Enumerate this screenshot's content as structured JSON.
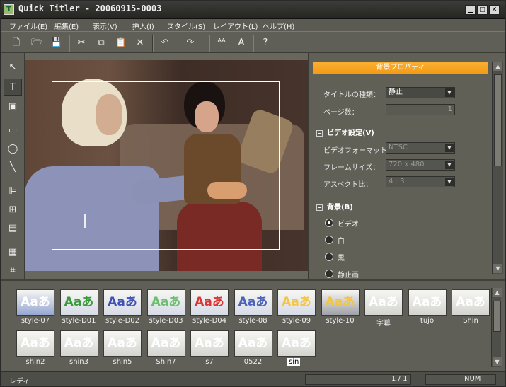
{
  "window": {
    "title": "Quick Titler - 20060915-0003"
  },
  "menu": [
    "ファイル(E)",
    "編集(E)",
    "表示(V)",
    "挿入(I)",
    "スタイル(S)",
    "レイアウト(L)",
    "ヘルプ(H)"
  ],
  "toolbar": {
    "icons": [
      "new-file-icon",
      "open-folder-icon",
      "save-icon",
      "cut-icon",
      "copy-icon",
      "paste-icon",
      "delete-icon",
      "undo-icon",
      "redo-icon",
      "text-style-icon",
      "text-effect-icon",
      "help-icon"
    ]
  },
  "left_tools": [
    "pointer-icon",
    "text-tool-icon",
    "image-tool-icon",
    "rectangle-tool-icon",
    "ellipse-tool-icon",
    "line-tool-icon",
    "align-left-icon",
    "align-center-icon",
    "layer-icon",
    "grid-icon",
    "safe-area-icon"
  ],
  "properties": {
    "header": "背景プロパティ",
    "title_type_label": "タイトルの種類：",
    "title_type_value": "静止",
    "page_count_label": "ページ数：",
    "page_count_value": "1",
    "video_section": "ビデオ設定(V)",
    "video_format_label": "ビデオフォーマット：",
    "video_format_value": "NTSC",
    "frame_size_label": "フレームサイズ：",
    "frame_size_value": "720 x 480",
    "aspect_label": "アスペクト比：",
    "aspect_value": "4 : 3",
    "background_section": "背景(B)",
    "radio_video": "ビデオ",
    "radio_white": "白",
    "radio_black": "黒",
    "radio_still": "静止画"
  },
  "styles": {
    "row1": [
      {
        "name": "style-07",
        "sample": "Aaあ",
        "fg": "#ffffff",
        "bg": "#95a7d2"
      },
      {
        "name": "style-D01",
        "sample": "Aaあ",
        "fg": "#3a9a3a",
        "bg": "#d7dbe6"
      },
      {
        "name": "style-D02",
        "sample": "Aaあ",
        "fg": "#3f51b5",
        "bg": "#d7dbe6"
      },
      {
        "name": "style-D03",
        "sample": "Aaあ",
        "fg": "#6cbf6c",
        "bg": "#d7dbe6"
      },
      {
        "name": "style-D04",
        "sample": "Aaあ",
        "fg": "#d33",
        "bg": "#d7dbe6"
      },
      {
        "name": "style-08",
        "sample": "Aaあ",
        "fg": "#4b62b8",
        "bg": "#d7dbe6"
      },
      {
        "name": "style-09",
        "sample": "Aaあ",
        "fg": "#f4c542",
        "bg": "#d7dbe6"
      },
      {
        "name": "style-10",
        "sample": "Aaあ",
        "fg": "#f4c542",
        "bg": "#9fa2a8"
      },
      {
        "name": "字幕",
        "sample": "Aaあ",
        "fg": "#ffffff",
        "bg": "#d4d4d0"
      },
      {
        "name": "tujo",
        "sample": "Aaあ",
        "fg": "#ffffff",
        "bg": "#d4d4d0"
      },
      {
        "name": "Shin",
        "sample": "Aaあ",
        "fg": "#ffffff",
        "bg": "#d4d4d0"
      }
    ],
    "row2": [
      {
        "name": "shin2",
        "sample": "Aaあ",
        "fg": "#ffffff",
        "bg": "#d4d4d0"
      },
      {
        "name": "shin3",
        "sample": "Aaあ",
        "fg": "#ffffff",
        "bg": "#d4d4d0"
      },
      {
        "name": "shin5",
        "sample": "Aaあ",
        "fg": "#ffffff",
        "bg": "#d4d4d0"
      },
      {
        "name": "Shin7",
        "sample": "Aaあ",
        "fg": "#ffffff",
        "bg": "#d4d4d0"
      },
      {
        "name": "s7",
        "sample": "Aaあ",
        "fg": "#ffffff",
        "bg": "#d4d4d0"
      },
      {
        "name": "0522",
        "sample": "Aaあ",
        "fg": "#ffffff",
        "bg": "#d4d4d0"
      },
      {
        "name": "sin",
        "sample": "Aaあ",
        "fg": "#ffffff",
        "bg": "#d4d4d0",
        "selected": true
      }
    ]
  },
  "status": {
    "left": "レディ",
    "page": "1 / 1",
    "num": "NUM"
  }
}
